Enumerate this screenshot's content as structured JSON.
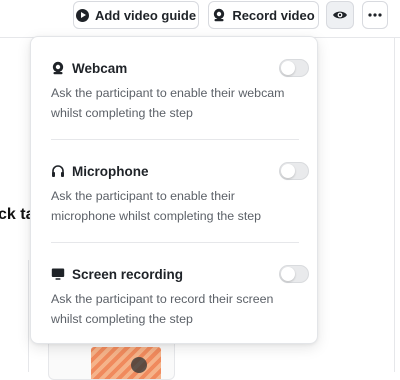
{
  "toolbar": {
    "add_video_guide": "Add video guide",
    "record_video": "Record video",
    "preview_icon": "eye-icon",
    "more_icon": "more-horizontal-icon"
  },
  "background": {
    "heading_fragment": "ck ta"
  },
  "popover": {
    "options": [
      {
        "icon": "webcam-icon",
        "title": "Webcam",
        "description": "Ask the participant to enable their webcam whilst completing the step",
        "enabled": false
      },
      {
        "icon": "headphones-icon",
        "title": "Microphone",
        "description": "Ask the participant to enable their microphone whilst completing the step",
        "enabled": false
      },
      {
        "icon": "monitor-icon",
        "title": "Screen recording",
        "description": "Ask the participant to record their screen whilst completing the step",
        "enabled": false
      }
    ]
  },
  "colors": {
    "text": "#1f2328",
    "muted": "#5c6168",
    "toggle_off": "#e9eaec",
    "border": "#e3e5e8"
  }
}
